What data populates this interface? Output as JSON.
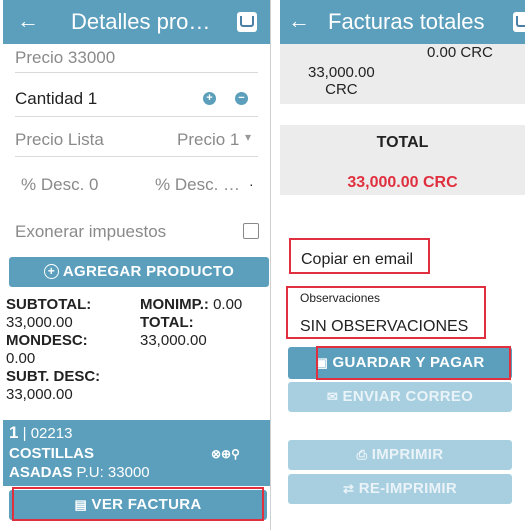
{
  "left": {
    "appbar": {
      "back_glyph": "←",
      "title": "Detalles pro…"
    },
    "precio_label": "Precio 33000",
    "cantidad_label": "Cantidad 1",
    "precio_lista_label": "Precio Lista",
    "precio_select": "Precio 1",
    "desc_1": "% Desc. 0",
    "desc_2": "% Desc. …",
    "exonerar_label": "Exonerar impuestos",
    "agregar_button": "AGREGAR PRODUCTO",
    "summary": {
      "subtotal_label": "SUBTOTAL:",
      "subtotal_value": "33,000.00",
      "monimp_label": "MONIMP.:",
      "monimp_value": "0.00",
      "total_label": "TOTAL:",
      "total_value": "33,000.00",
      "mondesc_label": "MONDESC:",
      "mondesc_value": "0.00",
      "subt_desc_label": "SUBT. DESC:",
      "subt_desc_value": "33,000.00"
    },
    "item": {
      "qty": "1",
      "code": " | 02213",
      "name_line1": "COSTILLAS",
      "name_line2": "ASADAS",
      "price": " P.U: 33000"
    },
    "ver_factura_button": "VER FACTURA"
  },
  "right": {
    "appbar": {
      "back_glyph": "←",
      "title": "Facturas totales"
    },
    "top_right_value": "0.00 CRC",
    "amount_line1": "33,000.00",
    "amount_line2": "CRC",
    "total_label": "TOTAL",
    "total_value": "33,000.00 CRC",
    "copiar_email": "Copiar en email",
    "observaciones_label": "Observaciones",
    "observaciones_value": "SIN OBSERVACIONES",
    "guardar_button": "GUARDAR Y PAGAR",
    "enviar_button": "ENVIAR CORREO",
    "imprimir_button": "IMPRIMIR",
    "reimprimir_button": "RE-IMPRIMIR"
  },
  "colors": {
    "primary": "#5b9fbd",
    "primary_disabled": "#a8cfe0",
    "total_red": "#e0303f",
    "highlight_box": "#e0303f"
  }
}
